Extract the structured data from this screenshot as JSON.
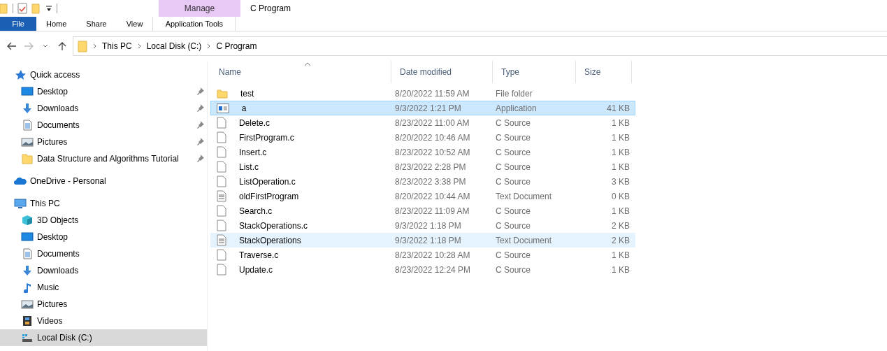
{
  "window": {
    "title": "C Program"
  },
  "ribbon": {
    "context_group": "Manage",
    "tabs": [
      {
        "label": "File",
        "kind": "file",
        "selected": false
      },
      {
        "label": "Home",
        "kind": "plain",
        "selected": false
      },
      {
        "label": "Share",
        "kind": "plain",
        "selected": false
      },
      {
        "label": "View",
        "kind": "plain",
        "selected": false
      },
      {
        "label": "Application Tools",
        "kind": "context",
        "selected": false
      }
    ]
  },
  "address": {
    "crumbs": [
      "This PC",
      "Local Disk (C:)",
      "C Program"
    ]
  },
  "sidebar": {
    "items": [
      {
        "label": "Quick access",
        "kind": "star",
        "selected": false,
        "children": [
          {
            "label": "Desktop",
            "kind": "desktop",
            "pinned": true,
            "selected": false
          },
          {
            "label": "Downloads",
            "kind": "download",
            "pinned": true,
            "selected": false
          },
          {
            "label": "Documents",
            "kind": "document",
            "pinned": true,
            "selected": false
          },
          {
            "label": "Pictures",
            "kind": "picture",
            "pinned": true,
            "selected": false
          },
          {
            "label": "Data Structure and Algorithms Tutorial",
            "kind": "folder",
            "pinned": true,
            "selected": false
          }
        ]
      },
      {
        "label": "OneDrive - Personal",
        "kind": "cloud",
        "selected": false
      },
      {
        "label": "This PC",
        "kind": "pc",
        "selected": false,
        "children": [
          {
            "label": "3D Objects",
            "kind": "cube",
            "pinned": false,
            "selected": false
          },
          {
            "label": "Desktop",
            "kind": "desktop",
            "pinned": false,
            "selected": false
          },
          {
            "label": "Documents",
            "kind": "document",
            "pinned": false,
            "selected": false
          },
          {
            "label": "Downloads",
            "kind": "download",
            "pinned": false,
            "selected": false
          },
          {
            "label": "Music",
            "kind": "music",
            "pinned": false,
            "selected": false
          },
          {
            "label": "Pictures",
            "kind": "picture",
            "pinned": false,
            "selected": false
          },
          {
            "label": "Videos",
            "kind": "video",
            "pinned": false,
            "selected": false
          },
          {
            "label": "Local Disk (C:)",
            "kind": "disk",
            "pinned": false,
            "selected": true
          }
        ]
      }
    ]
  },
  "table": {
    "columns": [
      "Name",
      "Date modified",
      "Type",
      "Size"
    ],
    "rows": [
      {
        "name": "test",
        "kind": "folder",
        "date": "8/20/2022 11:59 AM",
        "type": "File folder",
        "selected": false,
        "hovered": false
      },
      {
        "name": "a",
        "kind": "app",
        "date": "9/3/2022 1:21 PM",
        "type": "Application",
        "size": "41 KB",
        "selected": true,
        "hovered": false
      },
      {
        "name": "Delete.c",
        "kind": "file",
        "date": "8/23/2022 11:00 AM",
        "type": "C Source",
        "size": "1 KB",
        "selected": false,
        "hovered": false
      },
      {
        "name": "FirstProgram.c",
        "kind": "file",
        "date": "8/20/2022 10:46 AM",
        "type": "C Source",
        "size": "1 KB",
        "selected": false,
        "hovered": false
      },
      {
        "name": "Insert.c",
        "kind": "file",
        "date": "8/23/2022 10:52 AM",
        "type": "C Source",
        "size": "1 KB",
        "selected": false,
        "hovered": false
      },
      {
        "name": "List.c",
        "kind": "file",
        "date": "8/23/2022 2:28 PM",
        "type": "C Source",
        "size": "1 KB",
        "selected": false,
        "hovered": false
      },
      {
        "name": "ListOperation.c",
        "kind": "file",
        "date": "8/23/2022 3:38 PM",
        "type": "C Source",
        "size": "3 KB",
        "selected": false,
        "hovered": false
      },
      {
        "name": "oldFirstProgram",
        "kind": "text",
        "date": "8/20/2022 10:44 AM",
        "type": "Text Document",
        "size": "0 KB",
        "selected": false,
        "hovered": false
      },
      {
        "name": "Search.c",
        "kind": "file",
        "date": "8/23/2022 11:09 AM",
        "type": "C Source",
        "size": "1 KB",
        "selected": false,
        "hovered": false
      },
      {
        "name": "StackOperations.c",
        "kind": "file",
        "date": "9/3/2022 1:18 PM",
        "type": "C Source",
        "size": "2 KB",
        "selected": false,
        "hovered": false
      },
      {
        "name": "StackOperations",
        "kind": "text",
        "date": "9/3/2022 1:18 PM",
        "type": "Text Document",
        "size": "2 KB",
        "selected": false,
        "hovered": true
      },
      {
        "name": "Traverse.c",
        "kind": "file",
        "date": "8/23/2022 10:28 AM",
        "type": "C Source",
        "size": "1 KB",
        "selected": false,
        "hovered": false
      },
      {
        "name": "Update.c",
        "kind": "file",
        "date": "8/23/2022 12:24 PM",
        "type": "C Source",
        "size": "1 KB",
        "selected": false,
        "hovered": false
      }
    ]
  }
}
